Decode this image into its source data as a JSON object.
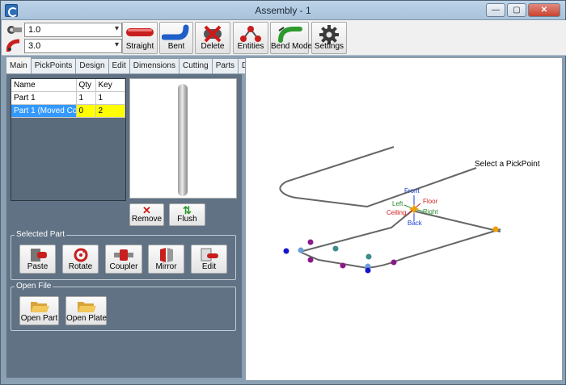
{
  "window": {
    "title": "Assembly - 1",
    "minimize": "—",
    "maximize": "▢",
    "close": "✕"
  },
  "toolbar": {
    "diameter_value": "1.0",
    "radius_value": "3.0",
    "buttons": [
      "Straight",
      "Bent",
      "Delete",
      "Entities",
      "Bend Mode",
      "Settings"
    ]
  },
  "tabs": [
    "Main",
    "PickPoints",
    "Design",
    "Edit",
    "Dimensions",
    "Cutting",
    "Parts",
    "Details"
  ],
  "parts_table": {
    "headers": [
      "Name",
      "Qty",
      "Key"
    ],
    "rows": [
      {
        "name": "Part 1",
        "qty": "1",
        "key": "1"
      },
      {
        "name": "Part 1 (Moved Co...",
        "qty": "0",
        "key": "2"
      }
    ]
  },
  "preview_buttons": {
    "remove": "Remove",
    "flush": "Flush"
  },
  "selected_part": {
    "title": "Selected Part",
    "buttons": [
      "Paste",
      "Rotate",
      "Coupler",
      "Mirror",
      "Edit"
    ]
  },
  "open_file": {
    "title": "Open File",
    "buttons": [
      "Open Part",
      "Open Plate"
    ]
  },
  "viewport": {
    "prompt": "Select a PickPoint",
    "gizmo": {
      "front": "Front",
      "left": "Left",
      "floor": "Floor",
      "ceiling": "Ceiling",
      "right": "Right",
      "back": "Back"
    },
    "colors": {
      "front": "#1a3fd0",
      "back": "#1a3fd0",
      "left": "#2d8a2d",
      "right": "#2d8a2d",
      "floor": "#d02020",
      "ceiling": "#d02020",
      "gizmo_center": "#f0a000"
    }
  }
}
